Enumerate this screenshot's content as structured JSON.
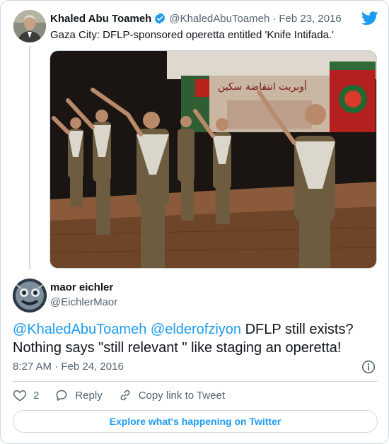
{
  "tweet1": {
    "author_name": "Khaled Abu Toameh",
    "handle": "@KhaledAbuToameh",
    "separator": "·",
    "date": "Feb 23, 2016",
    "text": "Gaza City: DFLP-sponsored operetta entitled 'Knife Intifada.'",
    "banner_text": "أوبريت انتفاضة سكين"
  },
  "tweet2": {
    "author_name": "maor eichler",
    "handle": "@EichlerMaor",
    "mention1": "@KhaledAbuToameh",
    "mention2": "@elderofziyon",
    "text_line1": " DFLP still exists?",
    "text_line2": "Nothing says \"still relevant \" like staging an operetta!",
    "time": "8:27 AM",
    "separator": "·",
    "date": "Feb 24, 2016"
  },
  "actions": {
    "like_count": "2",
    "reply_label": "Reply",
    "copy_label": "Copy link to Tweet"
  },
  "explore_label": "Explore what's happening on Twitter",
  "colors": {
    "accent": "#1d9bf0",
    "text": "#0f1419",
    "muted": "#536471",
    "border": "#cfd9de"
  },
  "icons": [
    "verified-badge-icon",
    "twitter-bird-icon",
    "info-icon",
    "heart-icon",
    "reply-icon",
    "link-icon"
  ]
}
